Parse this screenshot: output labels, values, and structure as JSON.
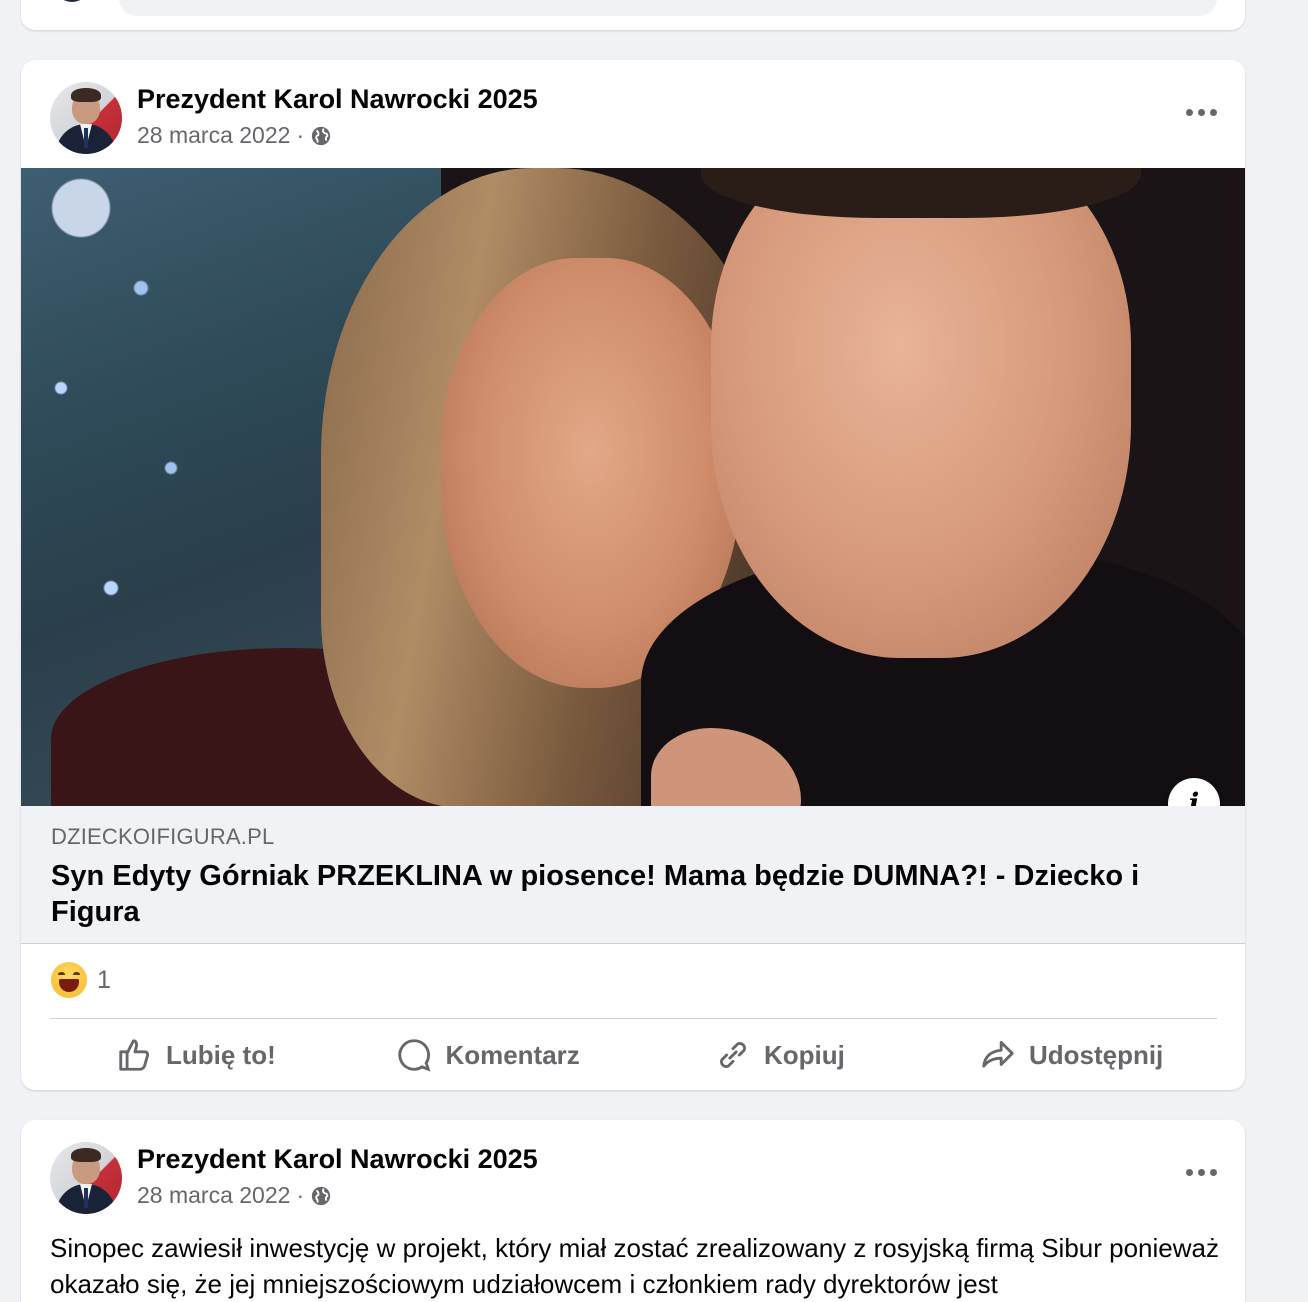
{
  "posts": [
    {
      "author": "Prezydent Karol Nawrocki 2025",
      "date": "28 marca 2022",
      "separator": "·",
      "privacy_icon": "globe-icon",
      "link": {
        "domain": "DZIECKOIFIGURA.PL",
        "title": "Syn Edyty Górniak PRZEKLINA w piosence! Mama będzie DUMNA?! - Dziecko i Figura",
        "info_icon": "i"
      },
      "reactions": {
        "emoji": "haha-emoji-icon",
        "count": "1"
      },
      "actions": [
        {
          "label": "Lubię to!",
          "icon": "like-icon"
        },
        {
          "label": "Komentarz",
          "icon": "comment-icon"
        },
        {
          "label": "Kopiuj",
          "icon": "link-icon"
        },
        {
          "label": "Udostępnij",
          "icon": "share-icon"
        }
      ]
    },
    {
      "author": "Prezydent Karol Nawrocki 2025",
      "date": "28 marca 2022",
      "separator": "·",
      "privacy_icon": "globe-icon",
      "text": "Sinopec zawiesił inwestycję w projekt, który miał zostać zrealizowany z rosyjską firmą Sibur ponieważ okazało się, że jej mniejszościowym udziałowcem i członkiem rady dyrektorów jest"
    }
  ],
  "colors": {
    "secondary_text": "#65676b",
    "page_bg": "#f0f2f5",
    "card_bg": "#ffffff"
  }
}
